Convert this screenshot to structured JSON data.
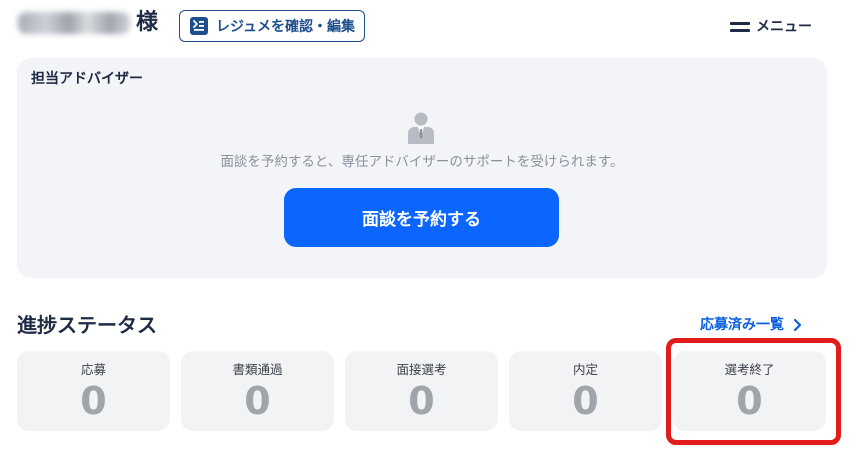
{
  "header": {
    "honorific": "様",
    "resume_button_label": "レジュメを確認・編集",
    "menu_label": "メニュー"
  },
  "advisor": {
    "title": "担当アドバイザー",
    "message": "面談を予約すると、専任アドバイザーのサポートを受けられます。",
    "reserve_button_label": "面談を予約する"
  },
  "progress": {
    "title": "進捗ステータス",
    "applied_link_label": "応募済み一覧",
    "statuses": [
      {
        "label": "応募",
        "count": "0"
      },
      {
        "label": "書類通過",
        "count": "0"
      },
      {
        "label": "面接選考",
        "count": "0"
      },
      {
        "label": "内定",
        "count": "0"
      },
      {
        "label": "選考終了",
        "count": "0"
      }
    ]
  },
  "icons": {
    "resume": "resume-icon",
    "menu": "menu-icon",
    "advisor": "advisor-person-icon",
    "chevron": "chevron-right-icon"
  },
  "colors": {
    "primary": "#0a66ff",
    "link": "#0a5fe0",
    "text_dark": "#1f2a44",
    "highlight": "#e21b1b",
    "card_bg": "#f2f4f8"
  }
}
